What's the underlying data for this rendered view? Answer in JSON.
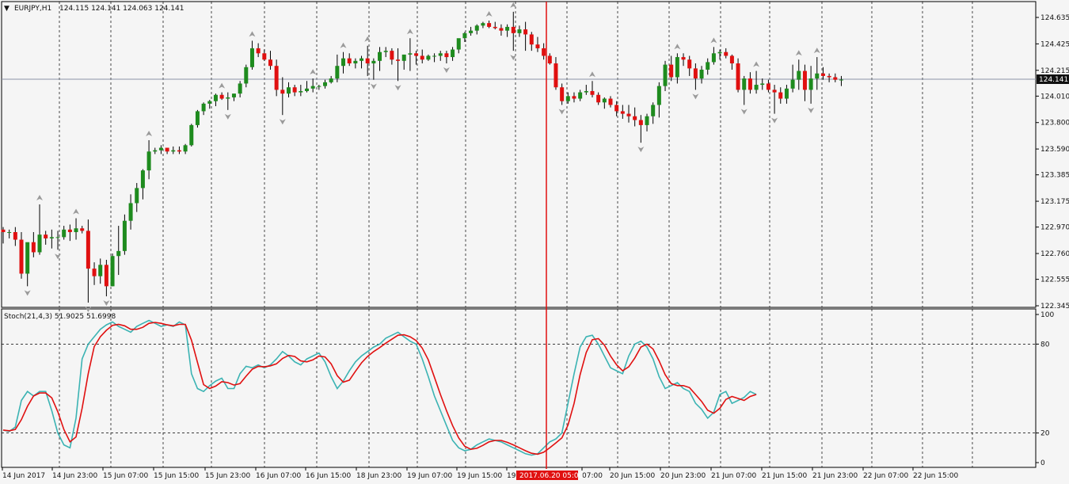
{
  "header": {
    "symbol_timeframe": "EURJPY,H1",
    "ohlc": "124.115 124.141 124.063 124.141"
  },
  "price_axis": {
    "ticks": [
      "124.635",
      "124.425",
      "124.215",
      "124.010",
      "123.800",
      "123.590",
      "123.385",
      "123.175",
      "122.970",
      "122.760",
      "122.555",
      "122.345"
    ],
    "current_price": "124.141"
  },
  "stoch": {
    "label": "Stoch(21,4,3) 51.9025 51.6998",
    "levels": [
      "100",
      "80",
      "20",
      "0"
    ]
  },
  "time_axis": {
    "labels": [
      "14 Jun 2017",
      "14 Jun 23:00",
      "15 Jun 07:00",
      "15 Jun 15:00",
      "15 Jun 23:00",
      "16 Jun 07:00",
      "16 Jun 15:00",
      "18 Jun 23:00",
      "19 Jun 07:00",
      "19 Jun 15:00",
      "19",
      "07:00",
      "20 Jun 15:00",
      "20 Jun 23:00",
      "21 Jun 07:00",
      "21 Jun 15:00",
      "21 Jun 23:00",
      "22 Jun 07:00",
      "22 Jun 15:00"
    ],
    "crosshair_time": "2017.06.20 05:00"
  },
  "colors": {
    "bull": "#1e8b1e",
    "bear": "#e01010",
    "main_line": "#3bb3b3",
    "signal_line": "#e01010",
    "crosshair": "#e01010"
  },
  "chart_data": {
    "type": "candlestick",
    "symbol": "EURJPY",
    "timeframe": "H1",
    "candles": [
      [
        122.95,
        122.97,
        122.84,
        122.93
      ],
      [
        122.93,
        122.95,
        122.88,
        122.93
      ],
      [
        122.93,
        122.97,
        122.82,
        122.87
      ],
      [
        122.87,
        122.93,
        122.56,
        122.6
      ],
      [
        122.6,
        122.83,
        122.5,
        122.85
      ],
      [
        122.85,
        122.93,
        122.73,
        122.77
      ],
      [
        122.77,
        123.15,
        122.75,
        122.91
      ],
      [
        122.91,
        122.94,
        122.83,
        122.88
      ],
      [
        122.88,
        122.95,
        122.8,
        122.89
      ],
      [
        122.89,
        122.94,
        122.79,
        122.89
      ],
      [
        122.89,
        122.98,
        122.87,
        122.95
      ],
      [
        122.95,
        122.99,
        122.86,
        122.93
      ],
      [
        122.93,
        123.04,
        122.87,
        122.96
      ],
      [
        122.96,
        122.98,
        122.92,
        122.94
      ],
      [
        122.94,
        123.03,
        122.37,
        122.64
      ],
      [
        122.64,
        122.69,
        122.51,
        122.58
      ],
      [
        122.58,
        122.72,
        122.52,
        122.67
      ],
      [
        122.67,
        122.71,
        122.42,
        122.5
      ],
      [
        122.5,
        122.76,
        122.5,
        122.74
      ],
      [
        122.74,
        122.98,
        122.59,
        122.78
      ],
      [
        122.78,
        123.07,
        122.75,
        123.02
      ],
      [
        123.02,
        123.23,
        122.95,
        123.16
      ],
      [
        123.16,
        123.32,
        123.09,
        123.28
      ],
      [
        123.28,
        123.43,
        123.19,
        123.42
      ],
      [
        123.42,
        123.66,
        123.35,
        123.57
      ],
      [
        123.57,
        123.6,
        123.55,
        123.58
      ],
      [
        123.58,
        123.62,
        123.55,
        123.6
      ],
      [
        123.6,
        123.6,
        123.55,
        123.57
      ],
      [
        123.57,
        123.61,
        123.55,
        123.58
      ],
      [
        123.58,
        123.61,
        123.55,
        123.57
      ],
      [
        123.57,
        123.63,
        123.55,
        123.62
      ],
      [
        123.62,
        123.79,
        123.61,
        123.78
      ],
      [
        123.78,
        123.9,
        123.76,
        123.89
      ],
      [
        123.89,
        123.96,
        123.86,
        123.95
      ],
      [
        123.95,
        123.98,
        123.91,
        123.97
      ],
      [
        123.97,
        124.03,
        123.93,
        124.02
      ],
      [
        124.02,
        124.04,
        123.98,
        123.99
      ],
      [
        123.99,
        124.04,
        123.9,
        124.0
      ],
      [
        124.0,
        124.03,
        123.97,
        124.03
      ],
      [
        124.03,
        124.13,
        124.0,
        124.11
      ],
      [
        124.11,
        124.26,
        124.08,
        124.24
      ],
      [
        124.24,
        124.45,
        124.22,
        124.39
      ],
      [
        124.39,
        124.43,
        124.32,
        124.35
      ],
      [
        124.35,
        124.38,
        124.29,
        124.3
      ],
      [
        124.3,
        124.37,
        124.22,
        124.25
      ],
      [
        124.25,
        124.3,
        124.01,
        124.06
      ],
      [
        124.06,
        124.16,
        123.86,
        124.03
      ],
      [
        124.03,
        124.12,
        124.0,
        124.08
      ],
      [
        124.08,
        124.1,
        124.01,
        124.04
      ],
      [
        124.04,
        124.1,
        124.01,
        124.05
      ],
      [
        124.05,
        124.13,
        124.04,
        124.07
      ],
      [
        124.07,
        124.15,
        124.04,
        124.09
      ],
      [
        124.09,
        124.1,
        124.06,
        124.09
      ],
      [
        124.09,
        124.14,
        124.07,
        124.12
      ],
      [
        124.12,
        124.17,
        124.11,
        124.15
      ],
      [
        124.15,
        124.34,
        124.12,
        124.25
      ],
      [
        124.25,
        124.36,
        124.19,
        124.31
      ],
      [
        124.31,
        124.35,
        124.25,
        124.27
      ],
      [
        124.27,
        124.31,
        124.23,
        124.29
      ],
      [
        124.29,
        124.33,
        124.23,
        124.31
      ],
      [
        124.31,
        124.41,
        124.17,
        124.27
      ],
      [
        124.27,
        124.31,
        124.14,
        124.29
      ],
      [
        124.29,
        124.4,
        124.21,
        124.36
      ],
      [
        124.36,
        124.4,
        124.32,
        124.37
      ],
      [
        124.37,
        124.39,
        124.26,
        124.3
      ],
      [
        124.3,
        124.39,
        124.13,
        124.29
      ],
      [
        124.29,
        124.33,
        124.22,
        124.34
      ],
      [
        124.34,
        124.47,
        124.21,
        124.35
      ],
      [
        124.35,
        124.37,
        124.26,
        124.33
      ],
      [
        124.33,
        124.38,
        124.27,
        124.3
      ],
      [
        124.3,
        124.34,
        124.29,
        124.33
      ],
      [
        124.33,
        124.35,
        124.28,
        124.33
      ],
      [
        124.33,
        124.37,
        124.29,
        124.35
      ],
      [
        124.35,
        124.37,
        124.27,
        124.32
      ],
      [
        124.32,
        124.4,
        124.29,
        124.38
      ],
      [
        124.38,
        124.46,
        124.35,
        124.47
      ],
      [
        124.47,
        124.52,
        124.44,
        124.51
      ],
      [
        124.51,
        124.56,
        124.49,
        124.53
      ],
      [
        124.53,
        124.58,
        124.5,
        124.57
      ],
      [
        124.57,
        124.6,
        124.55,
        124.59
      ],
      [
        124.59,
        124.61,
        124.55,
        124.56
      ],
      [
        124.56,
        124.6,
        124.54,
        124.55
      ],
      [
        124.55,
        124.58,
        124.49,
        124.53
      ],
      [
        124.53,
        124.58,
        124.48,
        124.56
      ],
      [
        124.56,
        124.68,
        124.37,
        124.51
      ],
      [
        124.51,
        124.57,
        124.48,
        124.54
      ],
      [
        124.54,
        124.6,
        124.37,
        124.5
      ],
      [
        124.5,
        124.52,
        124.37,
        124.42
      ],
      [
        124.42,
        124.48,
        124.36,
        124.39
      ],
      [
        124.39,
        124.43,
        124.3,
        124.33
      ],
      [
        124.33,
        124.35,
        124.26,
        124.27
      ],
      [
        124.27,
        124.32,
        124.06,
        124.08
      ],
      [
        124.08,
        124.11,
        123.94,
        123.97
      ],
      [
        123.97,
        124.04,
        123.95,
        124.01
      ],
      [
        124.01,
        124.04,
        123.96,
        123.99
      ],
      [
        123.99,
        124.06,
        123.97,
        124.04
      ],
      [
        124.04,
        124.1,
        124.02,
        124.05
      ],
      [
        124.05,
        124.13,
        124.0,
        124.02
      ],
      [
        124.02,
        124.04,
        123.94,
        123.96
      ],
      [
        123.96,
        124.0,
        123.91,
        123.99
      ],
      [
        123.99,
        124.01,
        123.92,
        123.94
      ],
      [
        123.94,
        123.97,
        123.85,
        123.89
      ],
      [
        123.89,
        123.94,
        123.83,
        123.87
      ],
      [
        123.87,
        123.94,
        123.8,
        123.85
      ],
      [
        123.85,
        123.92,
        123.77,
        123.82
      ],
      [
        123.82,
        123.86,
        123.64,
        123.78
      ],
      [
        123.78,
        123.87,
        123.73,
        123.85
      ],
      [
        123.85,
        123.96,
        123.79,
        123.94
      ],
      [
        123.94,
        124.12,
        123.84,
        124.09
      ],
      [
        124.09,
        124.29,
        124.05,
        124.26
      ],
      [
        124.26,
        124.33,
        124.13,
        124.16
      ],
      [
        124.16,
        124.35,
        124.11,
        124.32
      ],
      [
        124.32,
        124.35,
        124.25,
        124.3
      ],
      [
        124.3,
        124.33,
        124.17,
        124.23
      ],
      [
        124.23,
        124.27,
        124.06,
        124.15
      ],
      [
        124.15,
        124.25,
        124.11,
        124.22
      ],
      [
        124.22,
        124.31,
        124.18,
        124.28
      ],
      [
        124.28,
        124.4,
        124.26,
        124.35
      ],
      [
        124.35,
        124.38,
        124.3,
        124.36
      ],
      [
        124.36,
        124.39,
        124.31,
        124.33
      ],
      [
        124.33,
        124.34,
        124.22,
        124.27
      ],
      [
        124.27,
        124.31,
        124.04,
        124.06
      ],
      [
        124.06,
        124.17,
        123.94,
        124.15
      ],
      [
        124.15,
        124.2,
        124.03,
        124.06
      ],
      [
        124.06,
        124.21,
        124.03,
        124.1
      ],
      [
        124.1,
        124.15,
        124.06,
        124.11
      ],
      [
        124.11,
        124.14,
        124.04,
        124.06
      ],
      [
        124.06,
        124.1,
        123.87,
        124.04
      ],
      [
        124.04,
        124.08,
        123.95,
        123.99
      ],
      [
        123.99,
        124.1,
        123.95,
        124.07
      ],
      [
        124.07,
        124.26,
        124.04,
        124.14
      ],
      [
        124.14,
        124.3,
        124.06,
        124.21
      ],
      [
        124.21,
        124.26,
        123.97,
        124.06
      ],
      [
        124.06,
        124.25,
        123.95,
        124.15
      ],
      [
        124.15,
        124.32,
        124.06,
        124.19
      ],
      [
        124.19,
        124.24,
        124.14,
        124.17
      ],
      [
        124.17,
        124.19,
        124.12,
        124.16
      ],
      [
        124.16,
        124.19,
        124.12,
        124.14
      ],
      [
        124.14,
        124.17,
        124.09,
        124.141
      ]
    ],
    "stochastic": {
      "params": "21,4,3",
      "main": [
        22,
        21,
        24,
        42,
        48,
        45,
        48,
        48,
        35,
        20,
        12,
        10,
        30,
        70,
        80,
        85,
        90,
        93,
        95,
        92,
        90,
        88,
        92,
        94,
        96,
        94,
        92,
        93,
        92,
        95,
        93,
        60,
        50,
        48,
        52,
        55,
        57,
        50,
        50,
        60,
        65,
        64,
        66,
        64,
        66,
        70,
        75,
        72,
        68,
        66,
        70,
        72,
        74,
        68,
        58,
        50,
        55,
        62,
        68,
        72,
        75,
        78,
        80,
        84,
        86,
        88,
        85,
        82,
        80,
        70,
        58,
        45,
        35,
        25,
        15,
        10,
        8,
        9,
        12,
        14,
        16,
        15,
        14,
        12,
        10,
        8,
        6,
        5,
        6,
        10,
        14,
        16,
        20,
        40,
        60,
        78,
        85,
        86,
        80,
        72,
        64,
        62,
        60,
        72,
        80,
        82,
        78,
        70,
        58,
        50,
        52,
        54,
        50,
        48,
        40,
        36,
        30,
        34,
        46,
        48,
        40,
        42,
        44,
        48,
        46
      ]
    },
    "y_range": [
      122.345,
      124.635
    ],
    "x_range": [
      "14 Jun 2017",
      "22 Jun 15:00"
    ]
  }
}
